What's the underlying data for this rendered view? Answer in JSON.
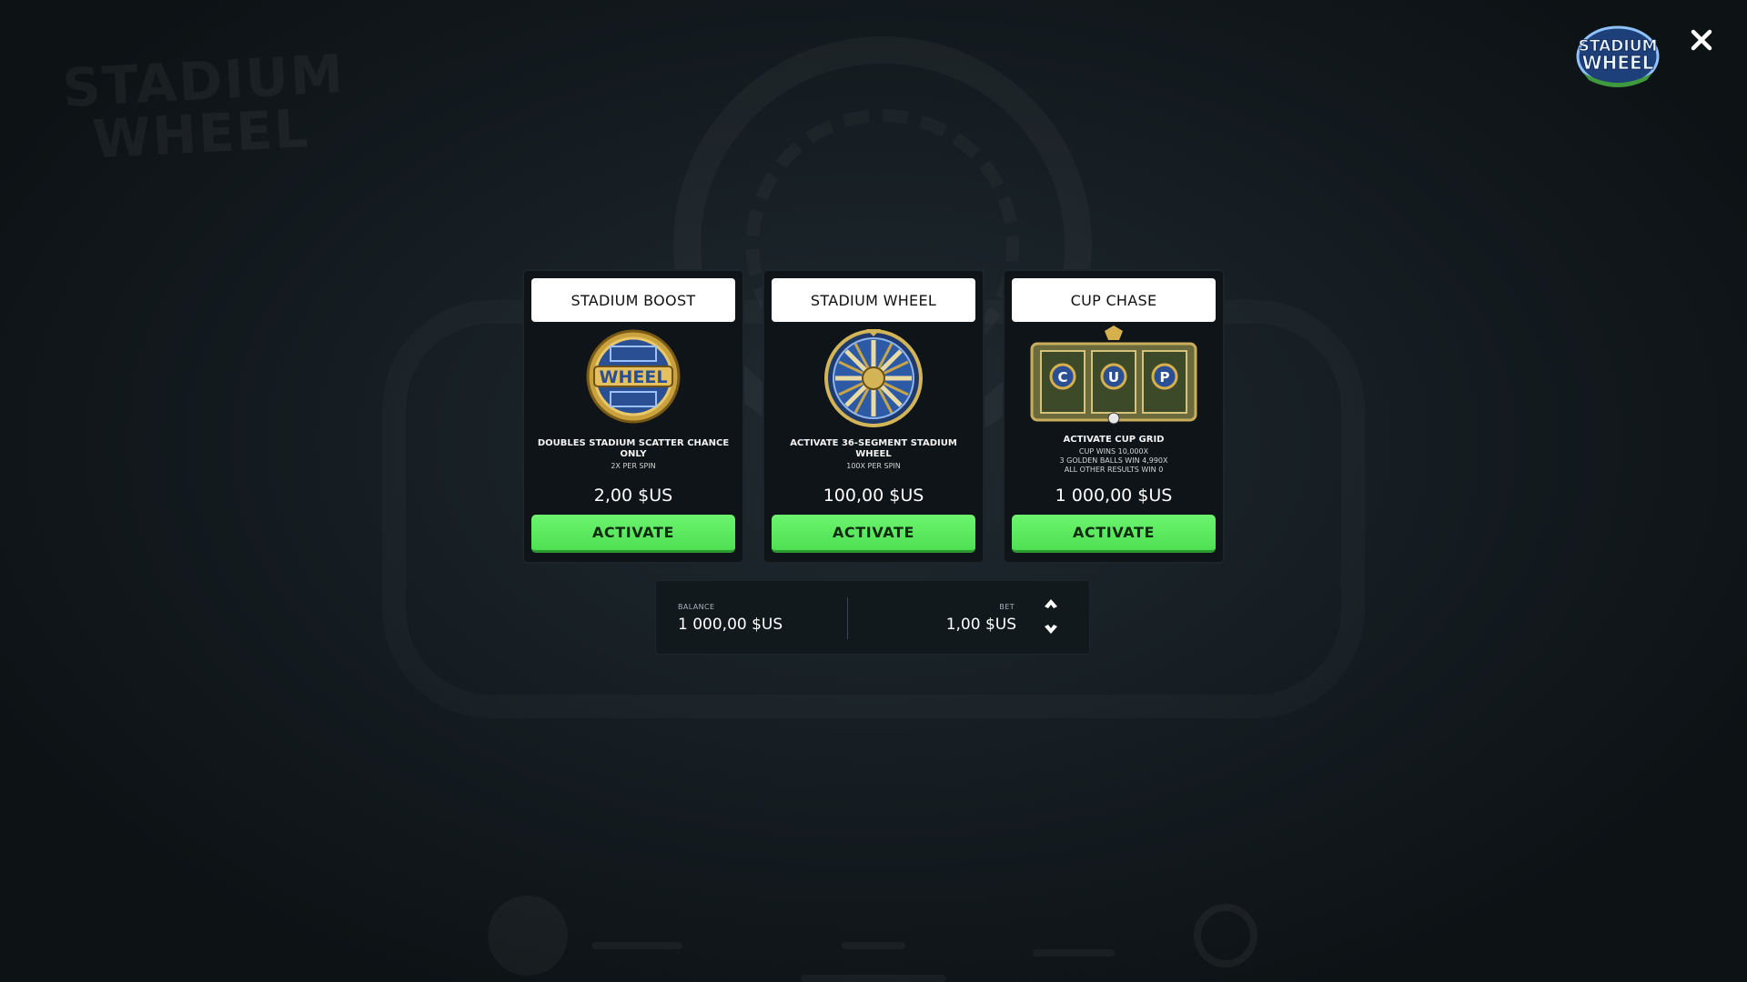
{
  "background": {
    "title_line1": "STADIUM",
    "title_line2": "WHEEL"
  },
  "header": {
    "logo_text_line1": "STADIUM",
    "logo_text_line2": "WHEEL",
    "close_icon": "close-icon"
  },
  "cards": [
    {
      "title": "STADIUM BOOST",
      "image_icon": "wheel-coin-icon",
      "image_text": "WHEEL",
      "desc_main": "DOUBLES STADIUM SCATTER CHANCE ONLY",
      "desc_sub": "2X PER SPIN",
      "price": "2,00 $US",
      "button_label": "ACTIVATE"
    },
    {
      "title": "STADIUM WHEEL",
      "image_icon": "stadium-wheel-icon",
      "desc_main": "ACTIVATE 36-SEGMENT STADIUM WHEEL",
      "desc_sub": "100X PER SPIN",
      "price": "100,00 $US",
      "button_label": "ACTIVATE"
    },
    {
      "title": "CUP CHASE",
      "image_icon": "cup-grid-icon",
      "image_letters": [
        "C",
        "U",
        "P"
      ],
      "desc_main": "ACTIVATE CUP GRID",
      "desc_sub_lines": [
        "CUP WINS 10,000X",
        "3 GOLDEN BALLS WIN 4,990X",
        "ALL OTHER RESULTS WIN 0"
      ],
      "price": "1 000,00 $US",
      "button_label": "ACTIVATE"
    }
  ],
  "wallet": {
    "balance_label": "BALANCE",
    "balance_value": "1 000,00 $US",
    "bet_label": "BET",
    "bet_value": "1,00 $US",
    "increase_icon": "chevron-up-icon",
    "decrease_icon": "chevron-down-icon"
  },
  "colors": {
    "activate_green": "#5ee862",
    "card_bg": "#0e1418",
    "gold": "#d9b24a",
    "blue": "#2f5aa8"
  }
}
